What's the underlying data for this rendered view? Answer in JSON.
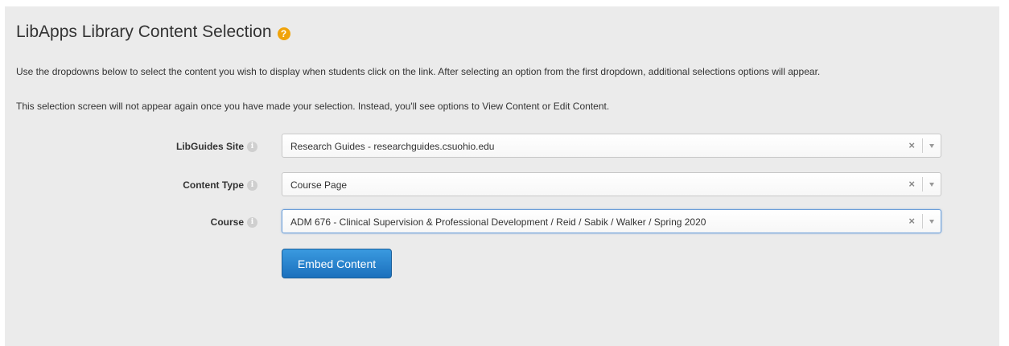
{
  "header": {
    "title": "LibApps Library Content Selection",
    "help_icon": "question-circle-icon",
    "help_glyph": "?"
  },
  "instructions": {
    "line1": "Use the dropdowns below to select the content you wish to display when students click on the link. After selecting an option from the first dropdown, additional selections options will appear.",
    "line2": "This selection screen will not appear again once you have made your selection. Instead, you'll see options to View Content or Edit Content."
  },
  "form": {
    "fields": [
      {
        "label": "LibGuides Site",
        "value": "Research Guides - researchguides.csuohio.edu",
        "icon": "info-icon"
      },
      {
        "label": "Content Type",
        "value": "Course Page",
        "icon": "info-icon"
      },
      {
        "label": "Course",
        "value": "ADM 676 - Clinical Supervision & Professional Development / Reid / Sabik / Walker / Spring 2020",
        "icon": "info-icon",
        "focused": true
      }
    ],
    "clear_glyph": "×",
    "info_glyph": "i",
    "submit_label": "Embed Content"
  },
  "colors": {
    "panel_background": "#ebebeb",
    "accent_button": "#2a84cf",
    "help_icon": "#f0a30a",
    "focus_border": "#6b9ed9"
  }
}
